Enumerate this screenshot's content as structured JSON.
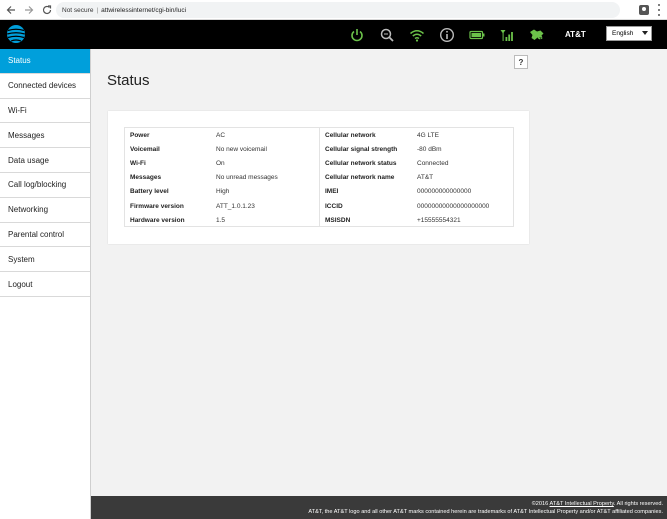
{
  "browser": {
    "security": "Not secure",
    "url": "attwirelessinternet/cgi-bin/luci"
  },
  "header": {
    "brand": "AT&T",
    "language": "English",
    "icons": [
      "power-icon",
      "search-icon",
      "wifi-icon",
      "info-icon",
      "battery-icon",
      "signal-icon",
      "lte-icon"
    ],
    "colors": {
      "background": "#000000",
      "icon_green": "#6cc24a",
      "accent": "#009fdb"
    }
  },
  "sidebar": {
    "items": [
      {
        "label": "Status",
        "active": true
      },
      {
        "label": "Connected devices"
      },
      {
        "label": "Wi-Fi"
      },
      {
        "label": "Messages"
      },
      {
        "label": "Data usage"
      },
      {
        "label": "Call log/blocking"
      },
      {
        "label": "Networking"
      },
      {
        "label": "Parental control"
      },
      {
        "label": "System"
      },
      {
        "label": "Logout"
      }
    ]
  },
  "main": {
    "help": "?",
    "title": "Status",
    "left_rows": [
      {
        "key": "Power",
        "value": "AC"
      },
      {
        "key": "Voicemail",
        "value": "No new voicemail"
      },
      {
        "key": "Wi-Fi",
        "value": "On"
      },
      {
        "key": "Messages",
        "value": "No unread messages"
      },
      {
        "key": "Battery level",
        "value": "High"
      },
      {
        "key": "Firmware version",
        "value": "ATT_1.0.1.23"
      },
      {
        "key": "Hardware version",
        "value": "1.5"
      }
    ],
    "right_rows": [
      {
        "key": "Cellular network",
        "value": "4G LTE"
      },
      {
        "key": "Cellular signal strength",
        "value": "-80 dBm"
      },
      {
        "key": "Cellular network status",
        "value": "Connected"
      },
      {
        "key": "Cellular network name",
        "value": "AT&T"
      },
      {
        "key": "IMEI",
        "value": "000000000000000"
      },
      {
        "key": "ICCID",
        "value": "00000000000000000000"
      },
      {
        "key": "MSISDN",
        "value": "+15555554321"
      }
    ]
  },
  "footer": {
    "line1_prefix": "©2016",
    "line1_link": "AT&T Intellectual Property",
    "line1_suffix": ". All rights reserved.",
    "line2": "AT&T, the AT&T logo and all other AT&T marks contained herein are trademarks of AT&T Intellectual Property and/or AT&T affiliated companies."
  }
}
